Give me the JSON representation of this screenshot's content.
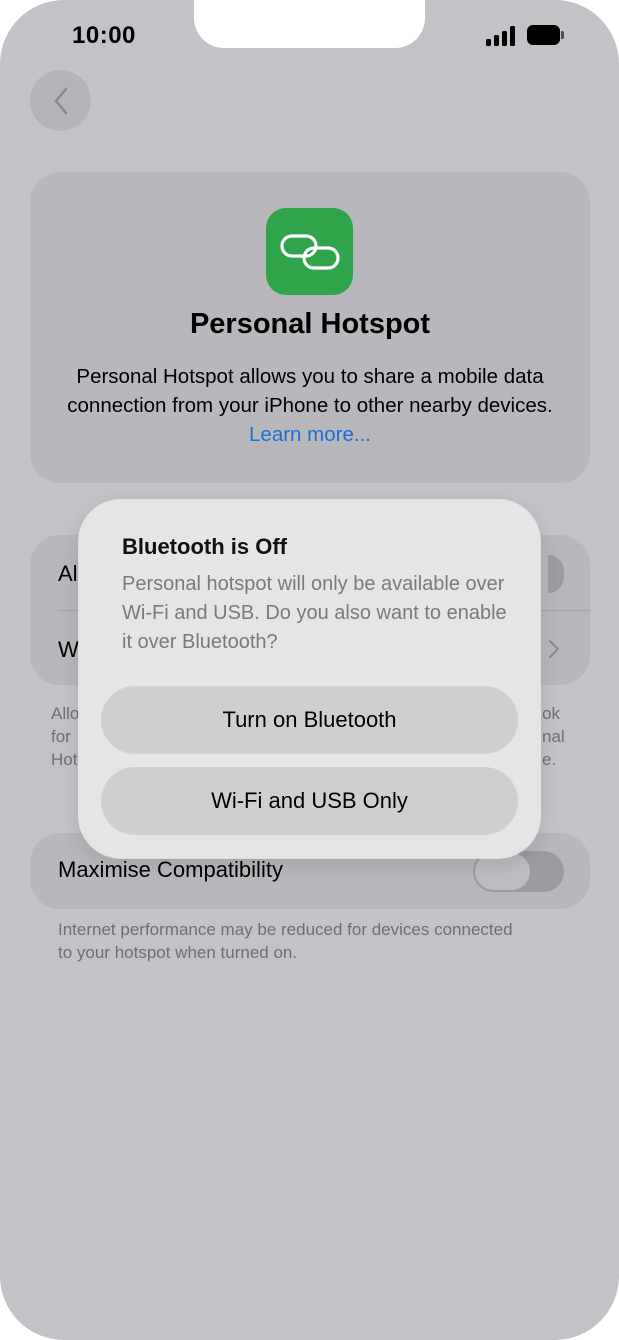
{
  "status_bar": {
    "time": "10:00"
  },
  "intro": {
    "title": "Personal Hotspot",
    "description": "Personal Hotspot allows you to share a mobile data connection from your iPhone to other nearby devices.",
    "link": "Learn more..."
  },
  "settings": {
    "row1_label_visible": "Al",
    "row2_label_visible": "W",
    "footnote_left": [
      "Allo",
      "for",
      "Hot"
    ],
    "footnote_right": [
      "ok",
      "nal",
      "e."
    ]
  },
  "compatibility": {
    "label": "Maximise Compatibility",
    "enabled": false,
    "footnote": "Internet performance may be reduced for devices connected to your hotspot when turned on."
  },
  "alert": {
    "title": "Bluetooth is Off",
    "message": "Personal hotspot will only be available over Wi-Fi and USB. Do you also want to enable it over Bluetooth?",
    "primary_button": "Turn on Bluetooth",
    "secondary_button": "Wi-Fi and USB Only"
  },
  "colors": {
    "app_icon": "#2fa44a",
    "link": "#1a6fd6",
    "dimmed_background": "#c3c3c7"
  },
  "icons": {
    "back": "chevron-left-icon",
    "app": "link-icon",
    "signal": "cellular-signal-icon",
    "battery": "battery-icon",
    "row_chevron": "chevron-right-icon"
  }
}
